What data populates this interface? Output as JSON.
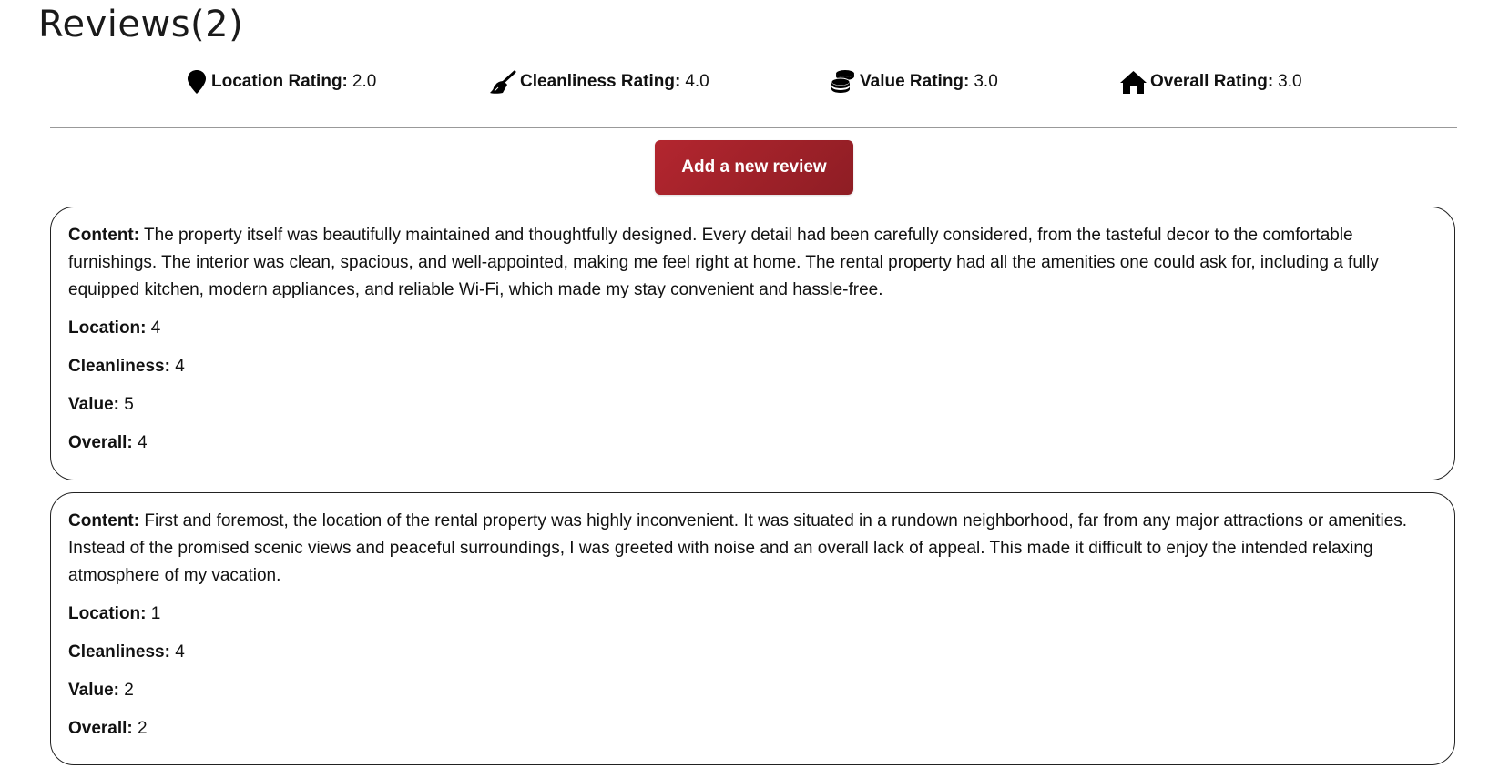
{
  "page": {
    "heading": "Reviews(2)"
  },
  "summary": {
    "location": {
      "icon": "map-pin-icon",
      "label": "Location Rating:",
      "value": "2.0"
    },
    "cleanliness": {
      "icon": "broom-icon",
      "label": "Cleanliness Rating:",
      "value": "4.0"
    },
    "value": {
      "icon": "coins-icon",
      "label": "Value Rating:",
      "value": "3.0"
    },
    "overall": {
      "icon": "house-icon",
      "label": "Overall Rating:",
      "value": "3.0"
    }
  },
  "add_review_label": "Add a new review",
  "colors": {
    "button_start": "#b3262f",
    "button_end": "#8e1d24",
    "text": "#111111",
    "border": "#222222"
  },
  "labels": {
    "content": "Content:",
    "location": "Location:",
    "cleanliness": "Cleanliness:",
    "value": "Value:",
    "overall": "Overall:"
  },
  "reviews": [
    {
      "content": "The property itself was beautifully maintained and thoughtfully designed. Every detail had been carefully considered, from the tasteful decor to the comfortable furnishings. The interior was clean, spacious, and well-appointed, making me feel right at home. The rental property had all the amenities one could ask for, including a fully equipped kitchen, modern appliances, and reliable Wi-Fi, which made my stay convenient and hassle-free.",
      "location": "4",
      "cleanliness": "4",
      "value": "5",
      "overall": "4"
    },
    {
      "content": "First and foremost, the location of the rental property was highly inconvenient. It was situated in a rundown neighborhood, far from any major attractions or amenities. Instead of the promised scenic views and peaceful surroundings, I was greeted with noise and an overall lack of appeal. This made it difficult to enjoy the intended relaxing atmosphere of my vacation.",
      "location": "1",
      "cleanliness": "4",
      "value": "2",
      "overall": "2"
    }
  ]
}
